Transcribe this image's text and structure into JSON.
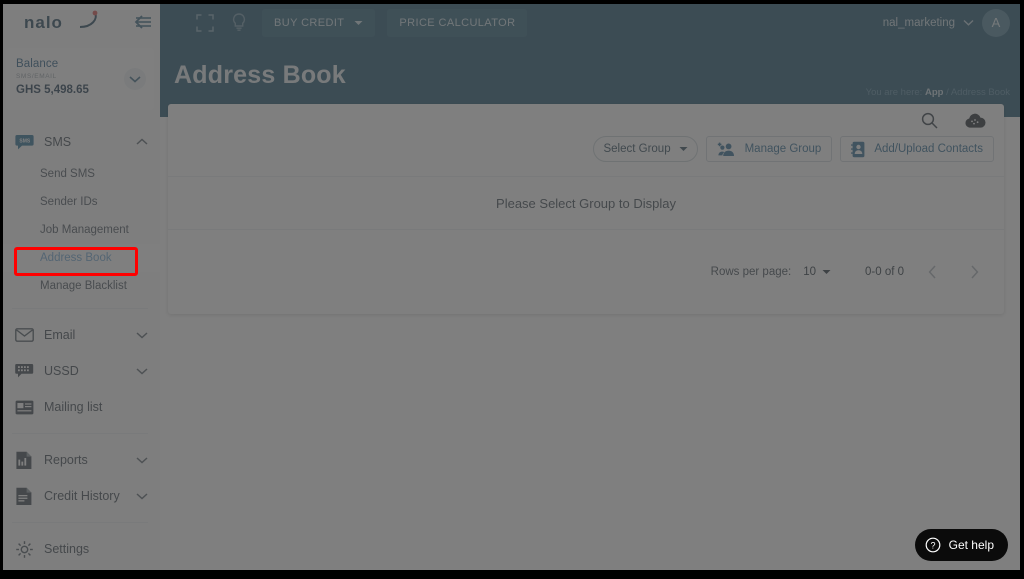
{
  "brand": {
    "logo_text": "nalo",
    "accent_color": "#1f5670",
    "highlight_color": "#ff0000"
  },
  "sidebar": {
    "balance": {
      "title": "Balance",
      "subtitle": "SMS/EMAIL",
      "amount": "GHS 5,498.65",
      "chevron_icon": "chevron-down-icon"
    },
    "groups": [
      {
        "label": "SMS",
        "icon": "sms-bubble-icon",
        "chevron": "chevron-up-icon",
        "expanded": true,
        "items": [
          {
            "label": "Send SMS",
            "active": false
          },
          {
            "label": "Sender IDs",
            "active": false
          },
          {
            "label": "Job Management",
            "active": false
          },
          {
            "label": "Address Book",
            "active": true
          },
          {
            "label": "Manage Blacklist",
            "active": false
          }
        ]
      },
      {
        "label": "Email",
        "icon": "envelope-icon",
        "chevron": "chevron-down-icon",
        "expanded": false,
        "items": []
      },
      {
        "label": "USSD",
        "icon": "ussd-icon",
        "chevron": "chevron-down-icon",
        "expanded": false,
        "items": []
      },
      {
        "label": "Mailing list",
        "icon": "mailing-list-icon",
        "chevron": "",
        "expanded": false,
        "items": []
      },
      {
        "label": "Reports",
        "icon": "report-icon",
        "chevron": "chevron-down-icon",
        "expanded": false,
        "items": []
      },
      {
        "label": "Credit History",
        "icon": "credit-history-icon",
        "chevron": "chevron-down-icon",
        "expanded": false,
        "items": []
      },
      {
        "label": "Settings",
        "icon": "gear-icon",
        "chevron": "",
        "expanded": false,
        "items": []
      }
    ]
  },
  "topbar": {
    "fullscreen_icon": "fullscreen-icon",
    "idea_icon": "lightbulb-icon",
    "buy_credit_label": "BUY CREDIT",
    "buy_credit_caret": "caret-down-icon",
    "price_calculator_label": "PRICE CALCULATOR",
    "username": "nal_marketing",
    "user_caret": "chevron-down-icon",
    "avatar_initial": "A"
  },
  "header": {
    "page_title": "Address Book",
    "breadcrumb_prefix": "You are here:",
    "breadcrumb_app": "App",
    "breadcrumb_sep": "/",
    "breadcrumb_current": "Address Book"
  },
  "card": {
    "search_icon": "search-icon",
    "cloud_icon": "cloud-upload-icon",
    "select_group_label": "Select Group",
    "select_group_caret": "caret-down-icon",
    "manage_group_label": "Manage Group",
    "manage_group_icon": "add-people-icon",
    "add_upload_label": "Add/Upload Contacts",
    "add_upload_icon": "contact-card-icon",
    "empty_message": "Please Select Group to Display",
    "pager": {
      "rows_per_page_label": "Rows per page:",
      "rows_per_page_value": "10",
      "rows_caret": "caret-down-icon",
      "range_label": "0-0 of 0",
      "prev_icon": "chevron-left-icon",
      "next_icon": "chevron-right-icon"
    }
  },
  "help_widget": {
    "label": "Get help",
    "icon": "question-circle-icon"
  }
}
